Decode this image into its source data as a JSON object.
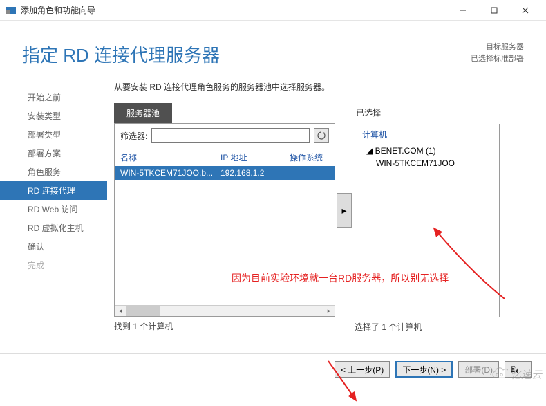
{
  "window": {
    "title": "添加角色和功能向导"
  },
  "header": {
    "page_title": "指定 RD 连接代理服务器",
    "target_label": "目标服务器",
    "target_value": "已选择标准部署"
  },
  "sidebar": {
    "items": [
      {
        "label": "开始之前",
        "active": false,
        "disabled": false
      },
      {
        "label": "安装类型",
        "active": false,
        "disabled": false
      },
      {
        "label": "部署类型",
        "active": false,
        "disabled": false
      },
      {
        "label": "部署方案",
        "active": false,
        "disabled": false
      },
      {
        "label": "角色服务",
        "active": false,
        "disabled": false
      },
      {
        "label": "RD 连接代理",
        "active": true,
        "disabled": false
      },
      {
        "label": "RD Web 访问",
        "active": false,
        "disabled": false
      },
      {
        "label": "RD 虚拟化主机",
        "active": false,
        "disabled": false
      },
      {
        "label": "确认",
        "active": false,
        "disabled": false
      },
      {
        "label": "完成",
        "active": false,
        "disabled": true
      }
    ]
  },
  "main": {
    "instruction": "从要安装 RD 连接代理角色服务的服务器池中选择服务器。",
    "pool_tab": "服务器池",
    "filter_label": "筛选器:",
    "filter_value": "",
    "columns": {
      "name": "名称",
      "ip": "IP 地址",
      "os": "操作系统"
    },
    "rows": [
      {
        "name": "WIN-5TKCEM71JOO.b...",
        "ip": "192.168.1.2",
        "os": ""
      }
    ],
    "found_text": "找到 1 个计算机",
    "selected_panel_label": "已选择",
    "selected_header": "计算机",
    "selected_tree": {
      "domain": "BENET.COM (1)",
      "host": "WIN-5TKCEM71JOO"
    },
    "selected_text": "选择了 1 个计算机"
  },
  "annotation": {
    "text": "因为目前实验环境就一台RD服务器，所以别无选择"
  },
  "buttons": {
    "prev": "< 上一步(P)",
    "next": "下一步(N) >",
    "deploy": "部署(D)",
    "cancel_partial": "取"
  },
  "watermark": {
    "text": "亿速云"
  }
}
